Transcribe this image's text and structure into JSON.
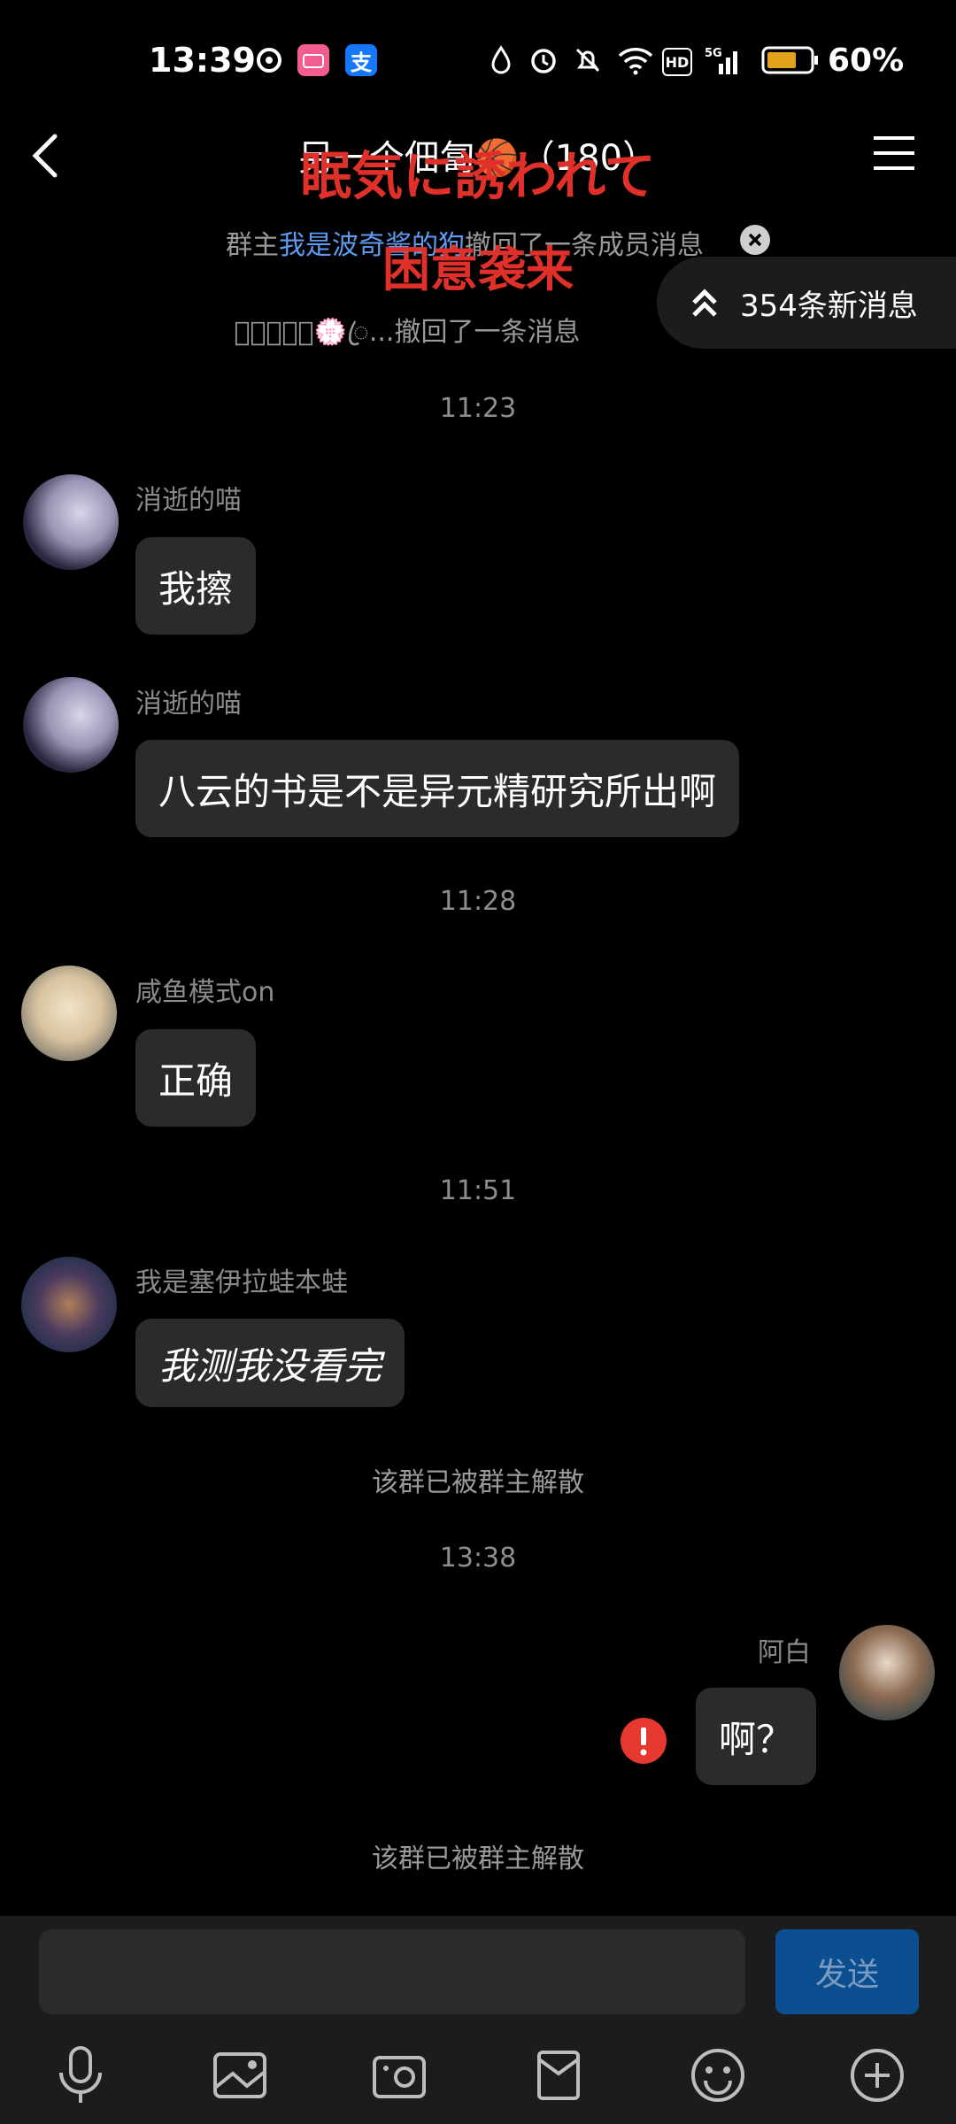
{
  "status_bar": {
    "time": "13:39",
    "battery_percent": "60%"
  },
  "header": {
    "title": "另一个佃匐🏀（180）",
    "overlay_line1": "眠気に誘われて",
    "overlay_line2": "困意袭来",
    "owner_notice_prefix": "群主",
    "owner_notice_name": "我是波奇酱的狗",
    "owner_notice_suffix": "撤回了一条成员消息",
    "recall_notice": "𝓛𝓸𝓿𝓮ꦿ💮ꦿ...撤回了一条消息",
    "new_messages": "354条新消息"
  },
  "messages": [
    {
      "time": "11:23"
    },
    {
      "nick": "消逝的喵",
      "text": "我擦"
    },
    {
      "nick": "消逝的喵",
      "text": "八云的书是不是异元精研究所出啊"
    },
    {
      "time": "11:28"
    },
    {
      "nick": "咸鱼模式on",
      "text": "正确"
    },
    {
      "time": "11:51"
    },
    {
      "nick": "我是塞伊拉蛙本蛙",
      "text": "我测我没看完"
    },
    {
      "system": "该群已被群主解散"
    },
    {
      "time": "13:38"
    },
    {
      "nick": "阿白",
      "text": "啊？"
    },
    {
      "system": "该群已被群主解散"
    }
  ],
  "input": {
    "send_label": "发送",
    "placeholder": ""
  },
  "colors": {
    "background": "#000000",
    "bubble": "#2b2b2b",
    "link": "#5e9cf2",
    "error": "#e5392f",
    "send_button": "#0c4f91"
  },
  "icons": [
    "back-icon",
    "menu-icon",
    "close-icon",
    "double-chevron-up-icon",
    "error-icon",
    "microphone-icon",
    "image-icon",
    "camera-icon",
    "file-icon",
    "emoji-icon",
    "plus-icon"
  ]
}
